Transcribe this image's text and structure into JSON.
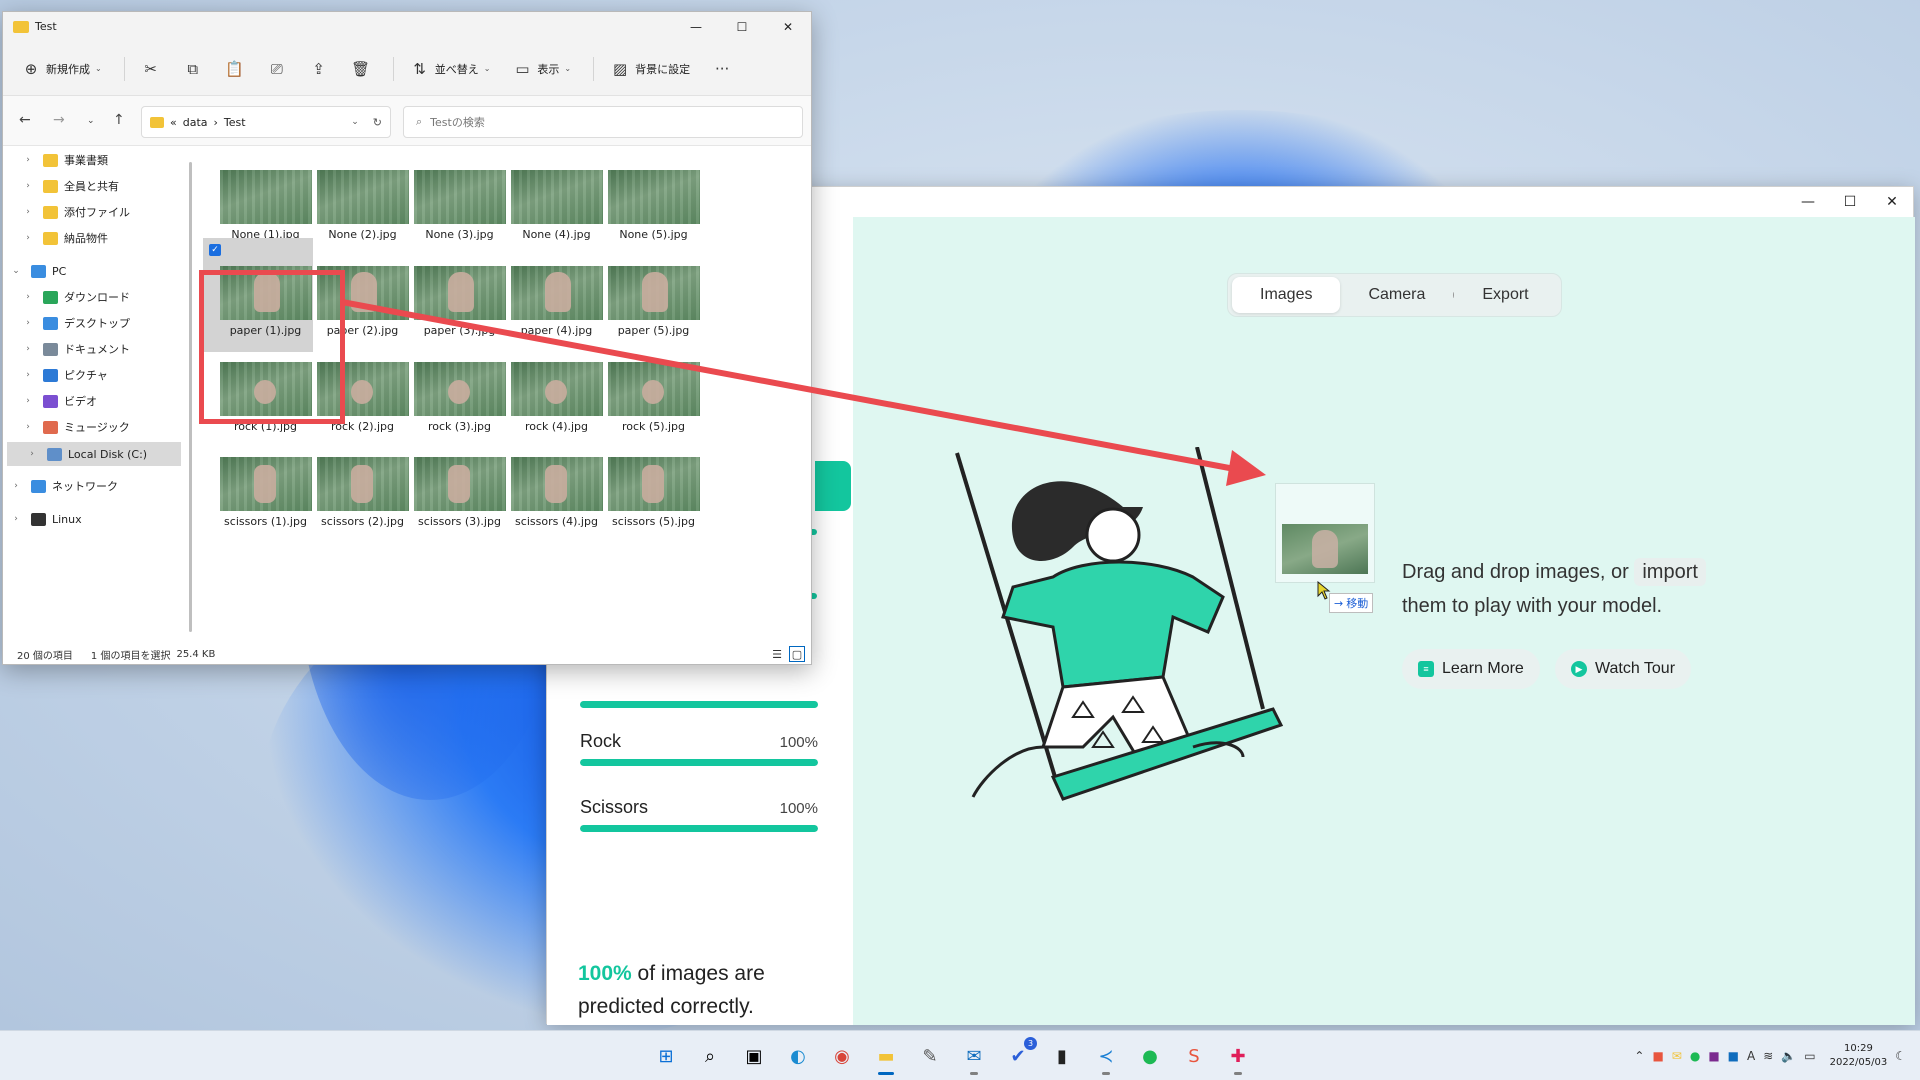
{
  "explorer": {
    "title": "Test",
    "toolbar": {
      "new": "新規作成",
      "sort": "並べ替え",
      "view": "表示",
      "set_background": "背景に設定",
      "more": "···"
    },
    "address": {
      "parts": [
        "«",
        "data",
        "›",
        "Test"
      ]
    },
    "search_placeholder": "Testの検索",
    "sidebar": [
      {
        "label": "事業書類",
        "icon": "folder-icon",
        "color": "#f2c338"
      },
      {
        "label": "全員と共有",
        "icon": "folder-icon",
        "color": "#f2c338"
      },
      {
        "label": "添付ファイル",
        "icon": "folder-icon",
        "color": "#f2c338"
      },
      {
        "label": "納品物件",
        "icon": "folder-icon",
        "color": "#f2c338"
      },
      {
        "label": "PC",
        "icon": "pc-icon",
        "color": "#3a8de0"
      },
      {
        "label": "ダウンロード",
        "icon": "download-icon",
        "color": "#2aa65a"
      },
      {
        "label": "デスクトップ",
        "icon": "desktop-icon",
        "color": "#3a8de0"
      },
      {
        "label": "ドキュメント",
        "icon": "document-icon",
        "color": "#7a8a9a"
      },
      {
        "label": "ピクチャ",
        "icon": "pictures-icon",
        "color": "#2d7ad6"
      },
      {
        "label": "ビデオ",
        "icon": "video-icon",
        "color": "#7b4fd1"
      },
      {
        "label": "ミュージック",
        "icon": "music-icon",
        "color": "#e06a4e"
      },
      {
        "label": "Local Disk (C:)",
        "icon": "disk-icon",
        "color": "#5f8fc9"
      },
      {
        "label": "ネットワーク",
        "icon": "network-icon",
        "color": "#3a8de0"
      },
      {
        "label": "Linux",
        "icon": "linux-icon",
        "color": "#333333"
      }
    ],
    "files": [
      [
        "None (1).jpg",
        "None (2).jpg",
        "None (3).jpg",
        "None (4).jpg",
        "None (5).jpg"
      ],
      [
        "paper (1).jpg",
        "paper (2).jpg",
        "paper (3).jpg",
        "paper (4).jpg",
        "paper (5).jpg"
      ],
      [
        "rock (1).jpg",
        "rock (2).jpg",
        "rock (3).jpg",
        "rock (4).jpg",
        "rock (5).jpg"
      ],
      [
        "scissors (1).jpg",
        "scissors (2).jpg",
        "scissors (3).jpg",
        "scissors (4).jpg",
        "scissors (5).jpg"
      ]
    ],
    "status": {
      "count": "20 個の項目",
      "selected": "1 個の項目を選択",
      "size": "25.4 KB"
    }
  },
  "teachable": {
    "tabs": [
      "Images",
      "Camera",
      "Export"
    ],
    "active_tab": "Images",
    "classes": [
      {
        "name": "Rock",
        "pct": "100%",
        "value": 1.0
      },
      {
        "name": "Scissors",
        "pct": "100%",
        "value": 1.0
      }
    ],
    "summary_pct": "100%",
    "summary_text": " of images are predicted correctly.",
    "drop_text": "Drag and drop images, or",
    "drop_import": "import",
    "drop_text2": "them to play with your model.",
    "learn_more": "Learn More",
    "watch_tour": "Watch Tour",
    "move_tip": "移動"
  },
  "taskbar": {
    "apps": [
      "windows-start-icon",
      "search-icon",
      "task-view-icon",
      "edge-icon",
      "chrome-icon",
      "file-explorer-icon",
      "notepad-icon",
      "outlook-icon",
      "todo-icon",
      "terminal-icon",
      "vscode-icon",
      "spotify-icon",
      "scratch-icon",
      "slack-icon"
    ],
    "todo_badge": "3",
    "time": "10:29",
    "date": "2022/05/03",
    "ime": "A"
  },
  "colors": {
    "accent": "#13c69e",
    "highlight": "#ea4a4f",
    "selection": "#cce4f7"
  }
}
